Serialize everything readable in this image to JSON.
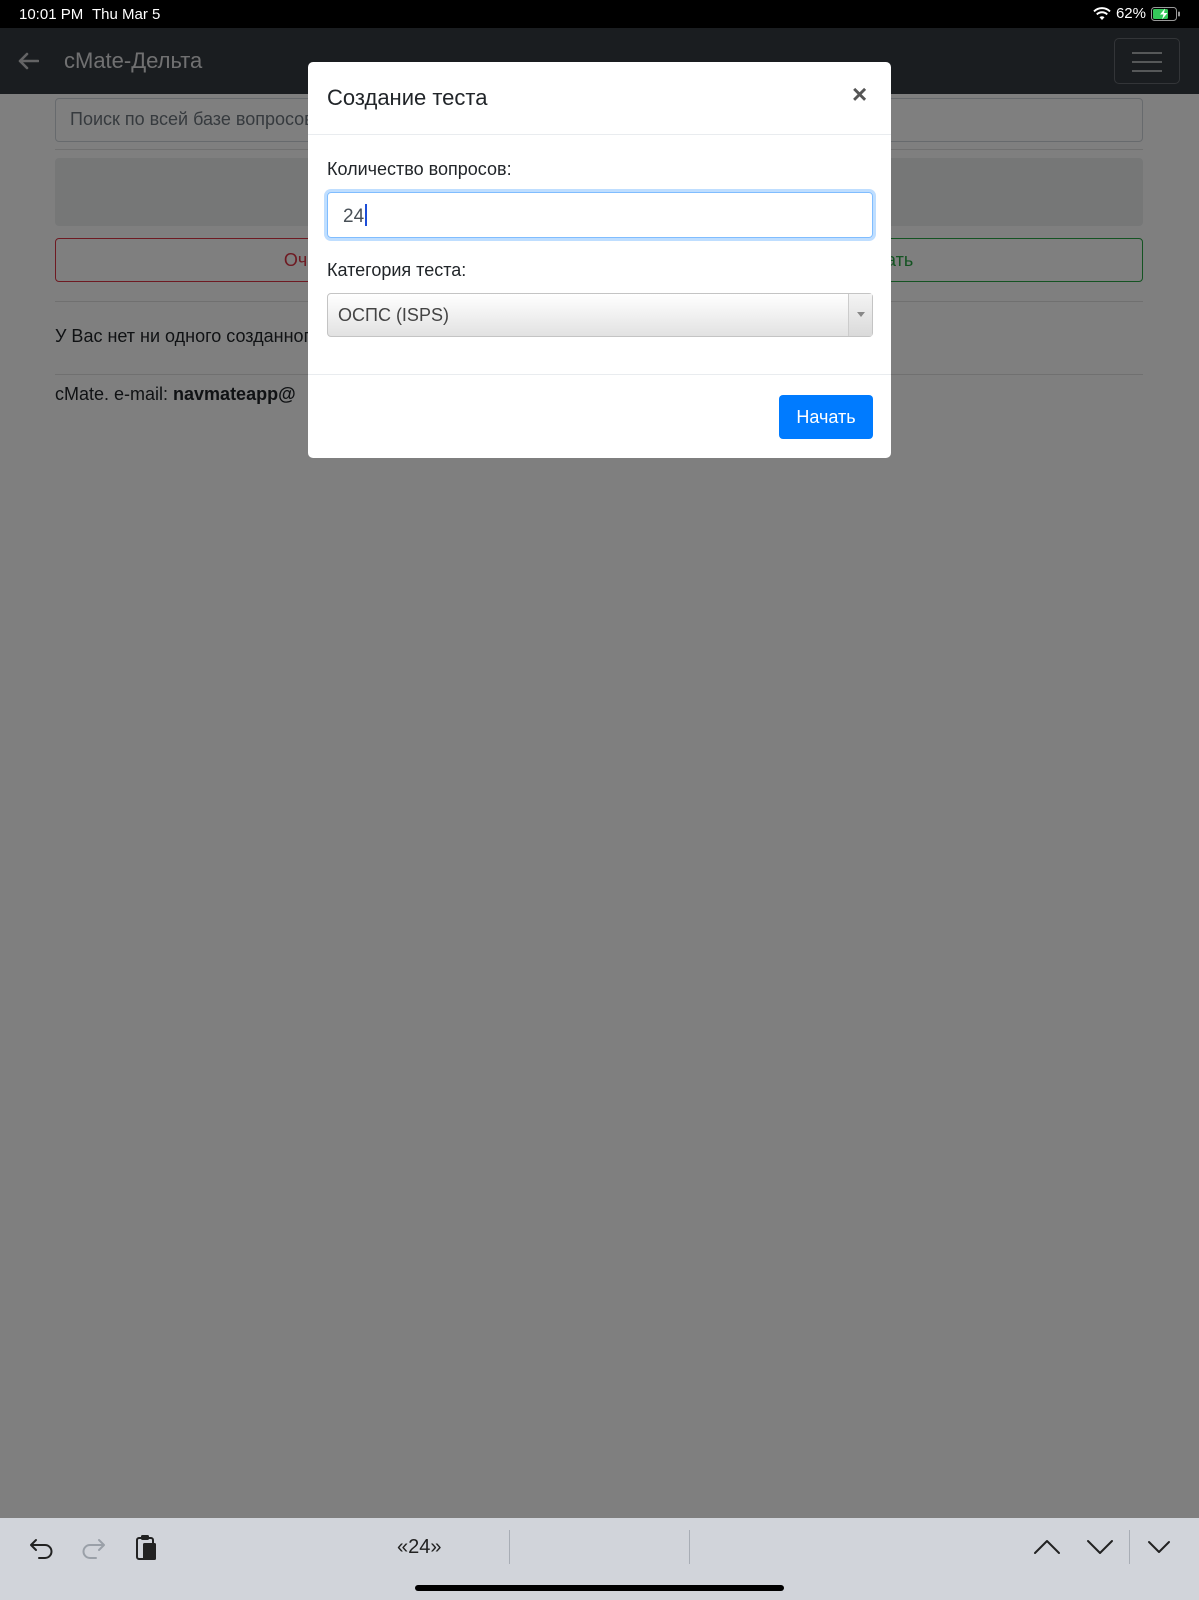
{
  "status_bar": {
    "time": "10:01 PM",
    "date": "Thu Mar 5",
    "battery": "62%",
    "icons": [
      "wifi-icon",
      "battery-charging-icon"
    ]
  },
  "navbar": {
    "title": "cMate-Дельта",
    "icons": [
      "arrow-left-icon",
      "hamburger-menu-icon"
    ]
  },
  "page": {
    "search_placeholder": "Поиск по всей базе вопросов",
    "clear_label": "Очистить",
    "show_label": "Показать",
    "empty_message": "У Вас нет ни одного созданного теста.",
    "footer_prefix": "cMate. e-mail: ",
    "footer_email": "navmateapp@"
  },
  "modal": {
    "title": "Создание теста",
    "close_label": "×",
    "count_label": "Количество вопросов:",
    "count_value": "24",
    "category_label": "Категория теста:",
    "category_selected": "ОСПС (ISPS)",
    "start_label": "Начать"
  },
  "keyboard_bar": {
    "suggestion": "«24»",
    "icons": [
      "undo-icon",
      "redo-icon",
      "paste-icon",
      "chevron-up-icon",
      "chevron-down-icon",
      "dismiss-keyboard-icon"
    ]
  },
  "colors": {
    "navbar": "#343a40",
    "primary": "#007bff",
    "danger": "#dc3545",
    "success": "#28a745",
    "backdrop": "rgba(0,0,0,0.5)"
  }
}
